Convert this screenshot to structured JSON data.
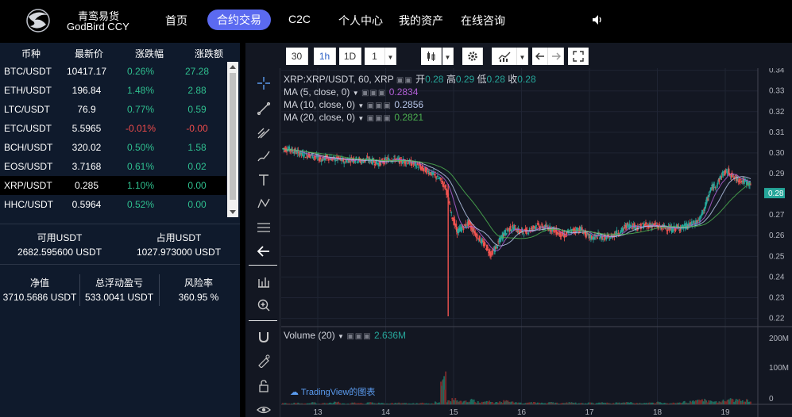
{
  "brand": {
    "cn": "青鸾易货",
    "en": "GodBird CCY"
  },
  "nav": [
    {
      "label": "首页",
      "left": 208
    },
    {
      "label": "合约交易",
      "active": true
    },
    {
      "label": "C2C"
    },
    {
      "label": "个人中心"
    },
    {
      "label": "我的资产"
    },
    {
      "label": "在线咨询"
    }
  ],
  "market": {
    "headers": [
      "币种",
      "最新价",
      "涨跌幅",
      "涨跌额"
    ],
    "rows": [
      {
        "pair": "BTC/USDT",
        "price": "10417.17",
        "pct": "0.26%",
        "chg": "27.28",
        "dir": "up"
      },
      {
        "pair": "ETH/USDT",
        "price": "196.84",
        "pct": "1.48%",
        "chg": "2.88",
        "dir": "up"
      },
      {
        "pair": "LTC/USDT",
        "price": "76.9",
        "pct": "0.77%",
        "chg": "0.59",
        "dir": "up"
      },
      {
        "pair": "ETC/USDT",
        "price": "5.5965",
        "pct": "-0.01%",
        "chg": "-0.00",
        "dir": "down"
      },
      {
        "pair": "BCH/USDT",
        "price": "320.02",
        "pct": "0.50%",
        "chg": "1.58",
        "dir": "up"
      },
      {
        "pair": "EOS/USDT",
        "price": "3.7168",
        "pct": "0.61%",
        "chg": "0.02",
        "dir": "up"
      },
      {
        "pair": "XRP/USDT",
        "price": "0.285",
        "pct": "1.10%",
        "chg": "0.00",
        "dir": "up",
        "selected": true
      },
      {
        "pair": "HHC/USDT",
        "price": "0.5964",
        "pct": "0.52%",
        "chg": "0.00",
        "dir": "up"
      }
    ]
  },
  "funds": {
    "available_label": "可用USDT",
    "available_value": "2682.595600 USDT",
    "occupied_label": "占用USDT",
    "occupied_value": "1027.973000 USDT"
  },
  "stats": {
    "equity_label": "净值",
    "equity_value": "3710.5686 USDT",
    "pnl_label": "总浮动盈亏",
    "pnl_value": "533.0041 USDT",
    "risk_label": "风险率",
    "risk_value": "360.95 %"
  },
  "toolbar": {
    "intervals": [
      "30",
      "1h",
      "1D",
      "1"
    ],
    "active_interval": "1h"
  },
  "legend": {
    "symbol": "XRP:XRP/USDT, 60, XRP",
    "open_label": "开",
    "open": "0.28",
    "high_label": "高",
    "high": "0.29",
    "low_label": "低",
    "low": "0.28",
    "close_label": "收",
    "close": "0.28",
    "ma": [
      {
        "label": "MA (5, close, 0)",
        "value": "0.2834",
        "color": "#b15fd4"
      },
      {
        "label": "MA (10, close, 0)",
        "value": "0.2856",
        "color": "#b6c5e8"
      },
      {
        "label": "MA (20, close, 0)",
        "value": "0.2821",
        "color": "#4caf50"
      }
    ],
    "volume_label": "Volume (20)",
    "volume_value": "2.636M",
    "tv_logo_text": "TradingView的图表"
  },
  "colors": {
    "up": "#26a69a",
    "down": "#ef5350",
    "accent": "#5b6af0"
  },
  "chart_data": {
    "type": "line",
    "title": "",
    "series_name": "XRP/USDT 60",
    "y_ticks": [
      "0.34",
      "0.33",
      "0.32",
      "0.31",
      "0.30",
      "0.29",
      "0.28",
      "0.27",
      "0.26",
      "0.25",
      "0.24",
      "0.23",
      "0.22"
    ],
    "y_range": [
      0.216,
      0.341
    ],
    "x_ticks": [
      "13",
      "14",
      "15",
      "16",
      "17",
      "18",
      "19"
    ],
    "last_price": "0.28",
    "volume_ticks": [
      "200M",
      "100M",
      "0"
    ],
    "price_path": [
      0.302,
      0.301,
      0.3,
      0.299,
      0.299,
      0.298,
      0.297,
      0.298,
      0.297,
      0.297,
      0.296,
      0.297,
      0.297,
      0.296,
      0.297,
      0.296,
      0.295,
      0.296,
      0.297,
      0.297,
      0.296,
      0.296,
      0.295,
      0.294,
      0.292,
      0.291,
      0.289,
      0.287,
      0.283,
      0.27,
      0.262,
      0.264,
      0.266,
      0.262,
      0.258,
      0.255,
      0.251,
      0.255,
      0.26,
      0.263,
      0.264,
      0.262,
      0.262,
      0.263,
      0.265,
      0.264,
      0.264,
      0.263,
      0.261,
      0.26,
      0.262,
      0.263,
      0.263,
      0.26,
      0.259,
      0.26,
      0.259,
      0.259,
      0.261,
      0.262,
      0.265,
      0.265,
      0.264,
      0.265,
      0.265,
      0.265,
      0.264,
      0.264,
      0.263,
      0.264,
      0.264,
      0.265,
      0.266,
      0.268,
      0.275,
      0.283,
      0.285,
      0.29,
      0.291,
      0.288,
      0.287,
      0.286,
      0.285
    ],
    "volume_path": [
      3,
      2,
      4,
      2,
      3,
      5,
      2,
      3,
      4,
      6,
      3,
      2,
      4,
      3,
      2,
      5,
      3,
      4,
      2,
      3,
      4,
      3,
      2,
      3,
      4,
      3,
      2,
      6,
      75,
      10,
      14,
      8,
      9,
      12,
      7,
      6,
      8,
      5,
      7,
      9,
      6,
      5,
      4,
      5,
      6,
      4,
      3,
      5,
      4,
      3,
      5,
      6,
      4,
      3,
      4,
      3,
      5,
      4,
      3,
      4,
      6,
      5,
      4,
      3,
      4,
      5,
      6,
      4,
      3,
      4,
      5,
      7,
      8,
      10,
      12,
      9,
      7,
      8,
      10,
      14,
      12,
      9,
      11
    ]
  }
}
